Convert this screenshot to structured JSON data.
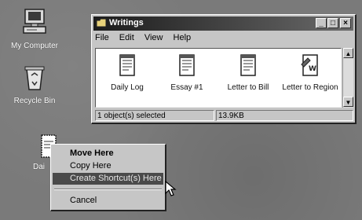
{
  "desktop": {
    "icons": [
      {
        "label": "My Computer",
        "icon": "my-computer-icon"
      },
      {
        "label": "Recycle Bin",
        "icon": "recycle-bin-icon"
      }
    ],
    "dragged_item_label": "Dai"
  },
  "window": {
    "title": "Writings",
    "buttons": {
      "minimize": "_",
      "maximize": "□",
      "close": "×"
    },
    "menu": [
      "File",
      "Edit",
      "View",
      "Help"
    ],
    "files": [
      {
        "label": "Daily Log",
        "icon": "document-icon"
      },
      {
        "label": "Essay #1",
        "icon": "document-icon"
      },
      {
        "label": "Letter to Bill",
        "icon": "document-icon"
      },
      {
        "label": "Letter to Region",
        "icon": "wordpad-document-icon"
      }
    ],
    "status": {
      "selection": "1 object(s) selected",
      "size": "13.9KB"
    },
    "scroll": {
      "up": "▲",
      "down": "▼"
    }
  },
  "context_menu": {
    "items": [
      "Move Here",
      "Copy Here",
      "Create Shortcut(s) Here",
      "Cancel"
    ]
  }
}
